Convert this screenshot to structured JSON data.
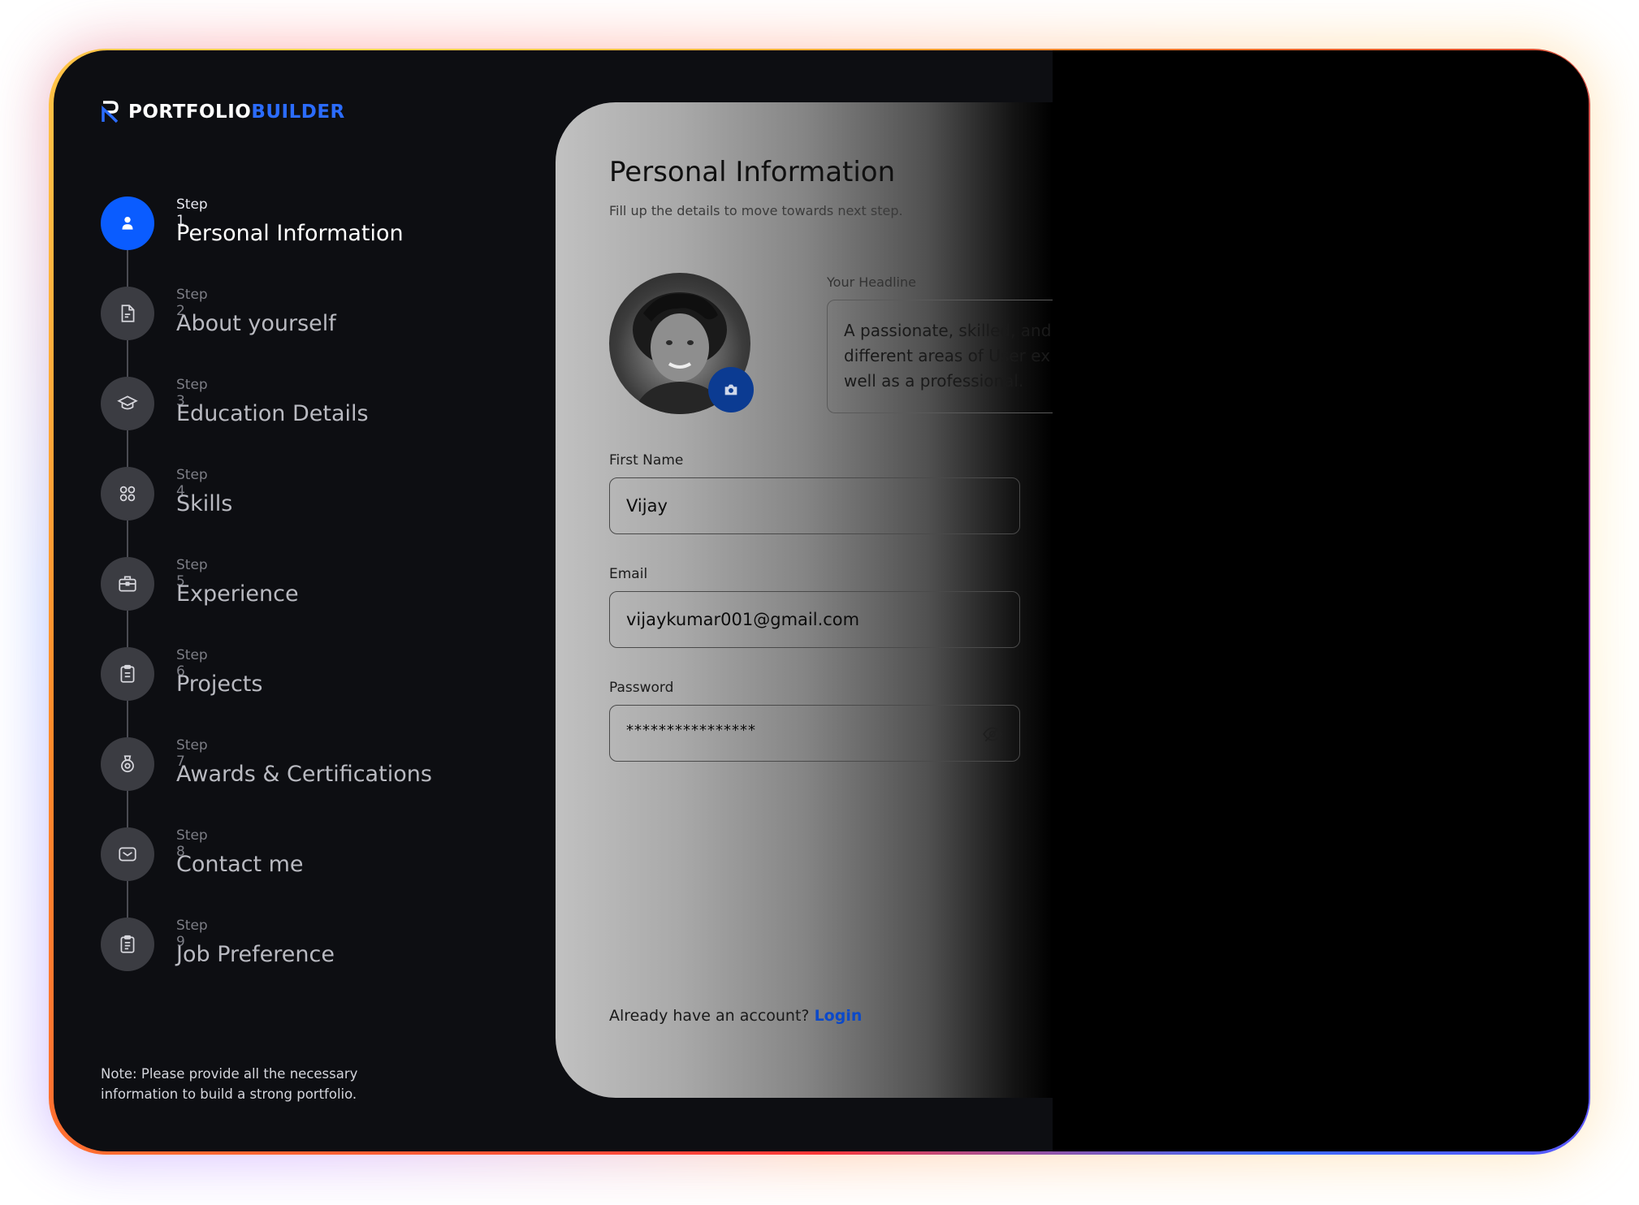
{
  "brand": {
    "name_part1": "PORTFOLIO",
    "name_part2": "BUILDER"
  },
  "steps": [
    {
      "num": "Step 1",
      "title": "Personal Information",
      "icon": "user-icon",
      "active": true
    },
    {
      "num": "Step 2",
      "title": "About yourself",
      "icon": "document-icon"
    },
    {
      "num": "Step 3",
      "title": "Education Details",
      "icon": "graduation-cap-icon"
    },
    {
      "num": "Step 4",
      "title": "Skills",
      "icon": "grid-icon"
    },
    {
      "num": "Step 5",
      "title": "Experience",
      "icon": "briefcase-icon"
    },
    {
      "num": "Step 6",
      "title": "Projects",
      "icon": "clipboard-icon"
    },
    {
      "num": "Step 7",
      "title": "Awards & Certifications",
      "icon": "award-icon"
    },
    {
      "num": "Step 8",
      "title": "Contact me",
      "icon": "mail-icon"
    },
    {
      "num": "Step 9",
      "title": "Job Preference",
      "icon": "clipboard-list-icon"
    }
  ],
  "note": "Note: Please provide all the necessary information to build a strong portfolio.",
  "form": {
    "title": "Personal Information",
    "subtitle": "Fill up the details to move towards next step.",
    "headline_label": "Your Headline",
    "headline_line1": "A passionate, skilled, and",
    "headline_line2": "different areas of User ex",
    "headline_line3": "well as a professional.",
    "first_name_label": "First Name",
    "first_name_value": "Vijay",
    "email_label": "Email",
    "email_value": "vijaykumar001@gmail.com",
    "password_label": "Password",
    "password_value": "****************",
    "login_prompt": "Already have an account?",
    "login_link": "Login"
  },
  "colors": {
    "accent": "#0a5cff",
    "panel": "#0d0e12",
    "link": "#0b49c9"
  }
}
